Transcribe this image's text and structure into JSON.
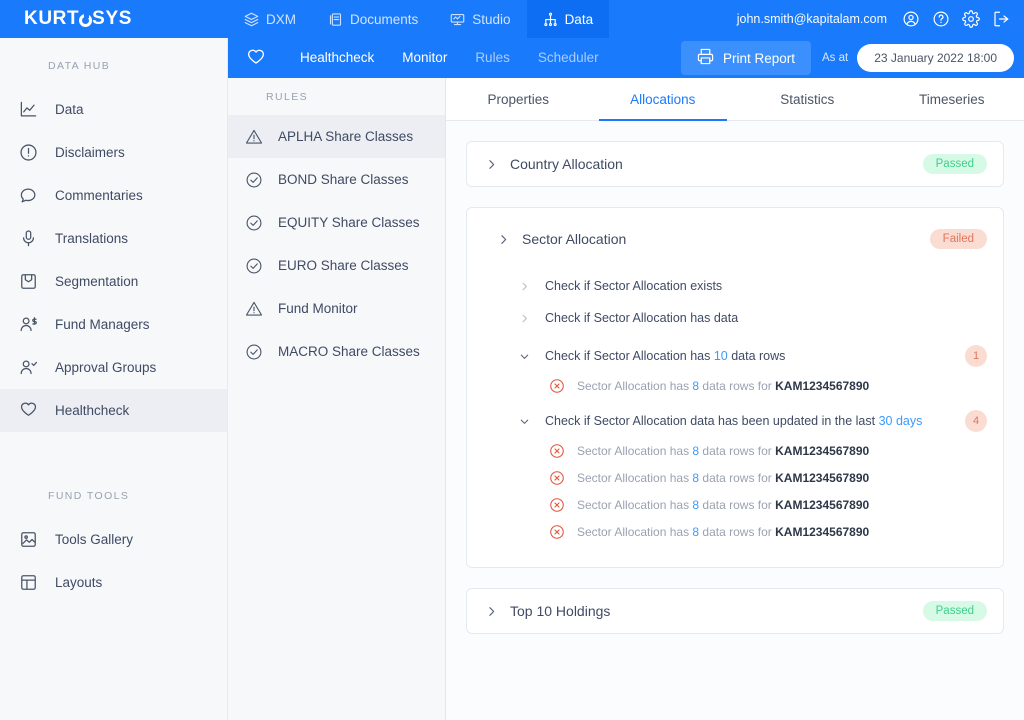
{
  "brand": {
    "name": "KURTOSYS",
    "accent": "#1a7afc"
  },
  "topnav": {
    "items": [
      {
        "label": "DXM",
        "icon": "layers-icon",
        "active": false
      },
      {
        "label": "Documents",
        "icon": "documents-icon",
        "active": false
      },
      {
        "label": "Studio",
        "icon": "studio-icon",
        "active": false
      },
      {
        "label": "Data",
        "icon": "data-icon",
        "active": true
      }
    ],
    "user_email": "john.smith@kapitalam.com",
    "icons": [
      "account-icon",
      "help-icon",
      "settings-icon",
      "logout-icon"
    ]
  },
  "subnav": {
    "favourite_icon": "heart-icon",
    "items": [
      {
        "label": "Healthcheck",
        "dim": false
      },
      {
        "label": "Monitor",
        "dim": false
      },
      {
        "label": "Rules",
        "dim": true
      },
      {
        "label": "Scheduler",
        "dim": true
      }
    ],
    "print_label": "Print Report",
    "print_icon": "printer-icon",
    "as_at_label": "As at",
    "as_at_value": "23 January 2022 18:00"
  },
  "sidebar": {
    "section_data_hub": "DATA HUB",
    "data_hub_items": [
      {
        "label": "Data",
        "icon": "chart-icon",
        "active": false
      },
      {
        "label": "Disclaimers",
        "icon": "info-circle-icon",
        "active": false
      },
      {
        "label": "Commentaries",
        "icon": "comment-icon",
        "active": false
      },
      {
        "label": "Translations",
        "icon": "microphone-icon",
        "active": false
      },
      {
        "label": "Segmentation",
        "icon": "inbox-icon",
        "active": false
      },
      {
        "label": "Fund Managers",
        "icon": "user-dollar-icon",
        "active": false
      },
      {
        "label": "Approval Groups",
        "icon": "user-check-icon",
        "active": false
      },
      {
        "label": "Healthcheck",
        "icon": "heart-icon",
        "active": true
      }
    ],
    "section_fund_tools": "FUND TOOLS",
    "fund_tools_items": [
      {
        "label": "Tools Gallery",
        "icon": "image-icon",
        "active": false
      },
      {
        "label": "Layouts",
        "icon": "layout-icon",
        "active": false
      }
    ]
  },
  "rules_panel": {
    "heading": "RULES",
    "items": [
      {
        "label": "APLHA Share Classes",
        "status": "warning",
        "active": true
      },
      {
        "label": "BOND Share Classes",
        "status": "ok",
        "active": false
      },
      {
        "label": "EQUITY Share Classes",
        "status": "ok",
        "active": false
      },
      {
        "label": "EURO Share Classes",
        "status": "ok",
        "active": false
      },
      {
        "label": "Fund Monitor",
        "status": "warning",
        "active": false
      },
      {
        "label": "MACRO Share Classes",
        "status": "ok",
        "active": false
      }
    ]
  },
  "tabs": [
    {
      "label": "Properties",
      "active": false
    },
    {
      "label": "Allocations",
      "active": true
    },
    {
      "label": "Statistics",
      "active": false
    },
    {
      "label": "Timeseries",
      "active": false
    }
  ],
  "allocations": {
    "country": {
      "title": "Country Allocation",
      "status": "Passed",
      "expanded": false
    },
    "sector": {
      "title": "Sector Allocation",
      "status": "Failed",
      "expanded": true,
      "checks": [
        {
          "label_prefix": "Check if Sector Allocation exists",
          "label_num": "",
          "label_suffix": "",
          "expanded": false,
          "count": "",
          "details": []
        },
        {
          "label_prefix": "Check if Sector Allocation has data",
          "label_num": "",
          "label_suffix": "",
          "expanded": false,
          "count": "",
          "details": []
        },
        {
          "label_prefix": "Check if Sector Allocation has ",
          "label_num": "10",
          "label_suffix": " data rows",
          "expanded": true,
          "count": "1",
          "details": [
            {
              "prefix": "Sector Allocation has ",
              "num": "8",
              "mid": " data rows for ",
              "ref": "KAM1234567890"
            }
          ]
        },
        {
          "label_prefix": "Check if Sector Allocation data has been updated in the last ",
          "label_num": "30 days",
          "label_suffix": "",
          "expanded": true,
          "count": "4",
          "details": [
            {
              "prefix": "Sector Allocation has ",
              "num": "8",
              "mid": " data rows for ",
              "ref": "KAM1234567890"
            },
            {
              "prefix": "Sector Allocation has ",
              "num": "8",
              "mid": " data rows for ",
              "ref": "KAM1234567890"
            },
            {
              "prefix": "Sector Allocation has ",
              "num": "8",
              "mid": " data rows for ",
              "ref": "KAM1234567890"
            },
            {
              "prefix": "Sector Allocation has ",
              "num": "8",
              "mid": " data rows for ",
              "ref": "KAM1234567890"
            }
          ]
        }
      ]
    },
    "top_holdings": {
      "title": "Top 10 Holdings",
      "status": "Passed",
      "expanded": false
    }
  },
  "colors": {
    "accent": "#1a7afc",
    "passed_bg": "#d6fae6",
    "passed_text": "#3ecf8e",
    "failed_bg": "#fadcd3",
    "failed_text": "#e2755c",
    "link_blue": "#3b9bfd"
  }
}
